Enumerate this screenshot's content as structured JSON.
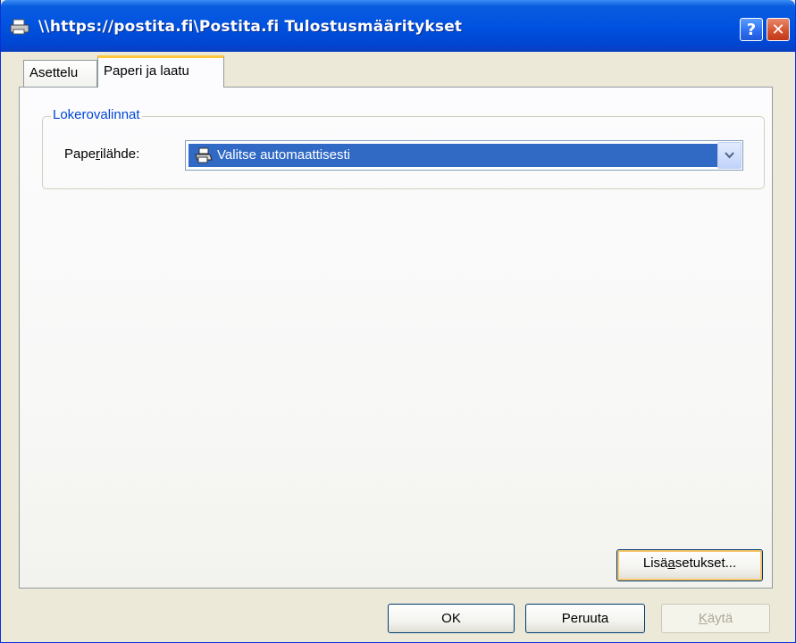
{
  "window": {
    "title": "\\\\https://postita.fi\\Postita.fi Tulostusmääritykset",
    "help_button": "?",
    "close_button": "✕"
  },
  "tabs": [
    {
      "label": "Asettelu",
      "selected": false
    },
    {
      "label": "Paperi ja laatu",
      "selected": true
    }
  ],
  "tray_group": {
    "title": "Lokerovalinnat",
    "paper_source_label_pre": "Pape",
    "paper_source_label_mnemonic": "r",
    "paper_source_label_post": "ilähde:",
    "paper_source_value": "Valitse automaattisesti"
  },
  "buttons": {
    "advanced_pre": "Lisä",
    "advanced_mnemonic": "a",
    "advanced_post": "setukset...",
    "ok": "OK",
    "cancel": "Peruuta",
    "apply_mnemonic": "K",
    "apply_post": "äytä"
  },
  "colors": {
    "titlebar": "#0052e0",
    "selection": "#316ac5",
    "active_tab_accent": "#ffc83c",
    "group_title": "#0046d5"
  },
  "icons": {
    "title": "printer-icon",
    "source": "printer-icon",
    "dropdown": "chevron-down-icon"
  }
}
